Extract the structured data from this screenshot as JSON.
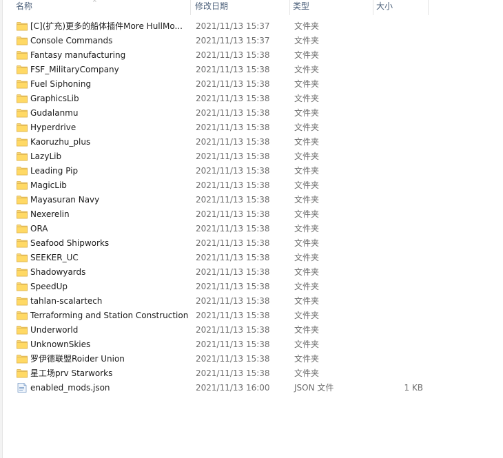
{
  "header": {
    "name": "名称",
    "date": "修改日期",
    "type": "类型",
    "size": "大小",
    "sort_indicator": "^"
  },
  "rows": [
    {
      "icon": "folder-icon",
      "name": "[C](扩充)更多的船体插件More HullMo...",
      "date": "2021/11/13 15:37",
      "type": "文件夹",
      "size": ""
    },
    {
      "icon": "folder-icon",
      "name": "Console Commands",
      "date": "2021/11/13 15:37",
      "type": "文件夹",
      "size": ""
    },
    {
      "icon": "folder-icon",
      "name": "Fantasy manufacturing",
      "date": "2021/11/13 15:38",
      "type": "文件夹",
      "size": ""
    },
    {
      "icon": "folder-icon",
      "name": "FSF_MilitaryCompany",
      "date": "2021/11/13 15:38",
      "type": "文件夹",
      "size": ""
    },
    {
      "icon": "folder-icon",
      "name": "Fuel Siphoning",
      "date": "2021/11/13 15:38",
      "type": "文件夹",
      "size": ""
    },
    {
      "icon": "folder-icon",
      "name": "GraphicsLib",
      "date": "2021/11/13 15:38",
      "type": "文件夹",
      "size": ""
    },
    {
      "icon": "folder-icon",
      "name": "Gudalanmu",
      "date": "2021/11/13 15:38",
      "type": "文件夹",
      "size": ""
    },
    {
      "icon": "folder-icon",
      "name": "Hyperdrive",
      "date": "2021/11/13 15:38",
      "type": "文件夹",
      "size": ""
    },
    {
      "icon": "folder-icon",
      "name": "Kaoruzhu_plus",
      "date": "2021/11/13 15:38",
      "type": "文件夹",
      "size": ""
    },
    {
      "icon": "folder-icon",
      "name": "LazyLib",
      "date": "2021/11/13 15:38",
      "type": "文件夹",
      "size": ""
    },
    {
      "icon": "folder-icon",
      "name": "Leading Pip",
      "date": "2021/11/13 15:38",
      "type": "文件夹",
      "size": ""
    },
    {
      "icon": "folder-icon",
      "name": "MagicLib",
      "date": "2021/11/13 15:38",
      "type": "文件夹",
      "size": ""
    },
    {
      "icon": "folder-icon",
      "name": "Mayasuran Navy",
      "date": "2021/11/13 15:38",
      "type": "文件夹",
      "size": ""
    },
    {
      "icon": "folder-icon",
      "name": "Nexerelin",
      "date": "2021/11/13 15:38",
      "type": "文件夹",
      "size": ""
    },
    {
      "icon": "folder-icon",
      "name": "ORA",
      "date": "2021/11/13 15:38",
      "type": "文件夹",
      "size": ""
    },
    {
      "icon": "folder-icon",
      "name": "Seafood Shipworks",
      "date": "2021/11/13 15:38",
      "type": "文件夹",
      "size": ""
    },
    {
      "icon": "folder-icon",
      "name": "SEEKER_UC",
      "date": "2021/11/13 15:38",
      "type": "文件夹",
      "size": ""
    },
    {
      "icon": "folder-icon",
      "name": "Shadowyards",
      "date": "2021/11/13 15:38",
      "type": "文件夹",
      "size": ""
    },
    {
      "icon": "folder-icon",
      "name": "SpeedUp",
      "date": "2021/11/13 15:38",
      "type": "文件夹",
      "size": ""
    },
    {
      "icon": "folder-icon",
      "name": "tahlan-scalartech",
      "date": "2021/11/13 15:38",
      "type": "文件夹",
      "size": ""
    },
    {
      "icon": "folder-icon",
      "name": "Terraforming and Station Construction",
      "date": "2021/11/13 15:38",
      "type": "文件夹",
      "size": ""
    },
    {
      "icon": "folder-icon",
      "name": "Underworld",
      "date": "2021/11/13 15:38",
      "type": "文件夹",
      "size": ""
    },
    {
      "icon": "folder-icon",
      "name": "UnknownSkies",
      "date": "2021/11/13 15:38",
      "type": "文件夹",
      "size": ""
    },
    {
      "icon": "folder-icon",
      "name": "罗伊德联盟Roider Union",
      "date": "2021/11/13 15:38",
      "type": "文件夹",
      "size": ""
    },
    {
      "icon": "folder-icon",
      "name": "星工场prv Starworks",
      "date": "2021/11/13 15:38",
      "type": "文件夹",
      "size": ""
    },
    {
      "icon": "json-file-icon",
      "name": "enabled_mods.json",
      "date": "2021/11/13 16:00",
      "type": "JSON 文件",
      "size": "1 KB"
    }
  ]
}
